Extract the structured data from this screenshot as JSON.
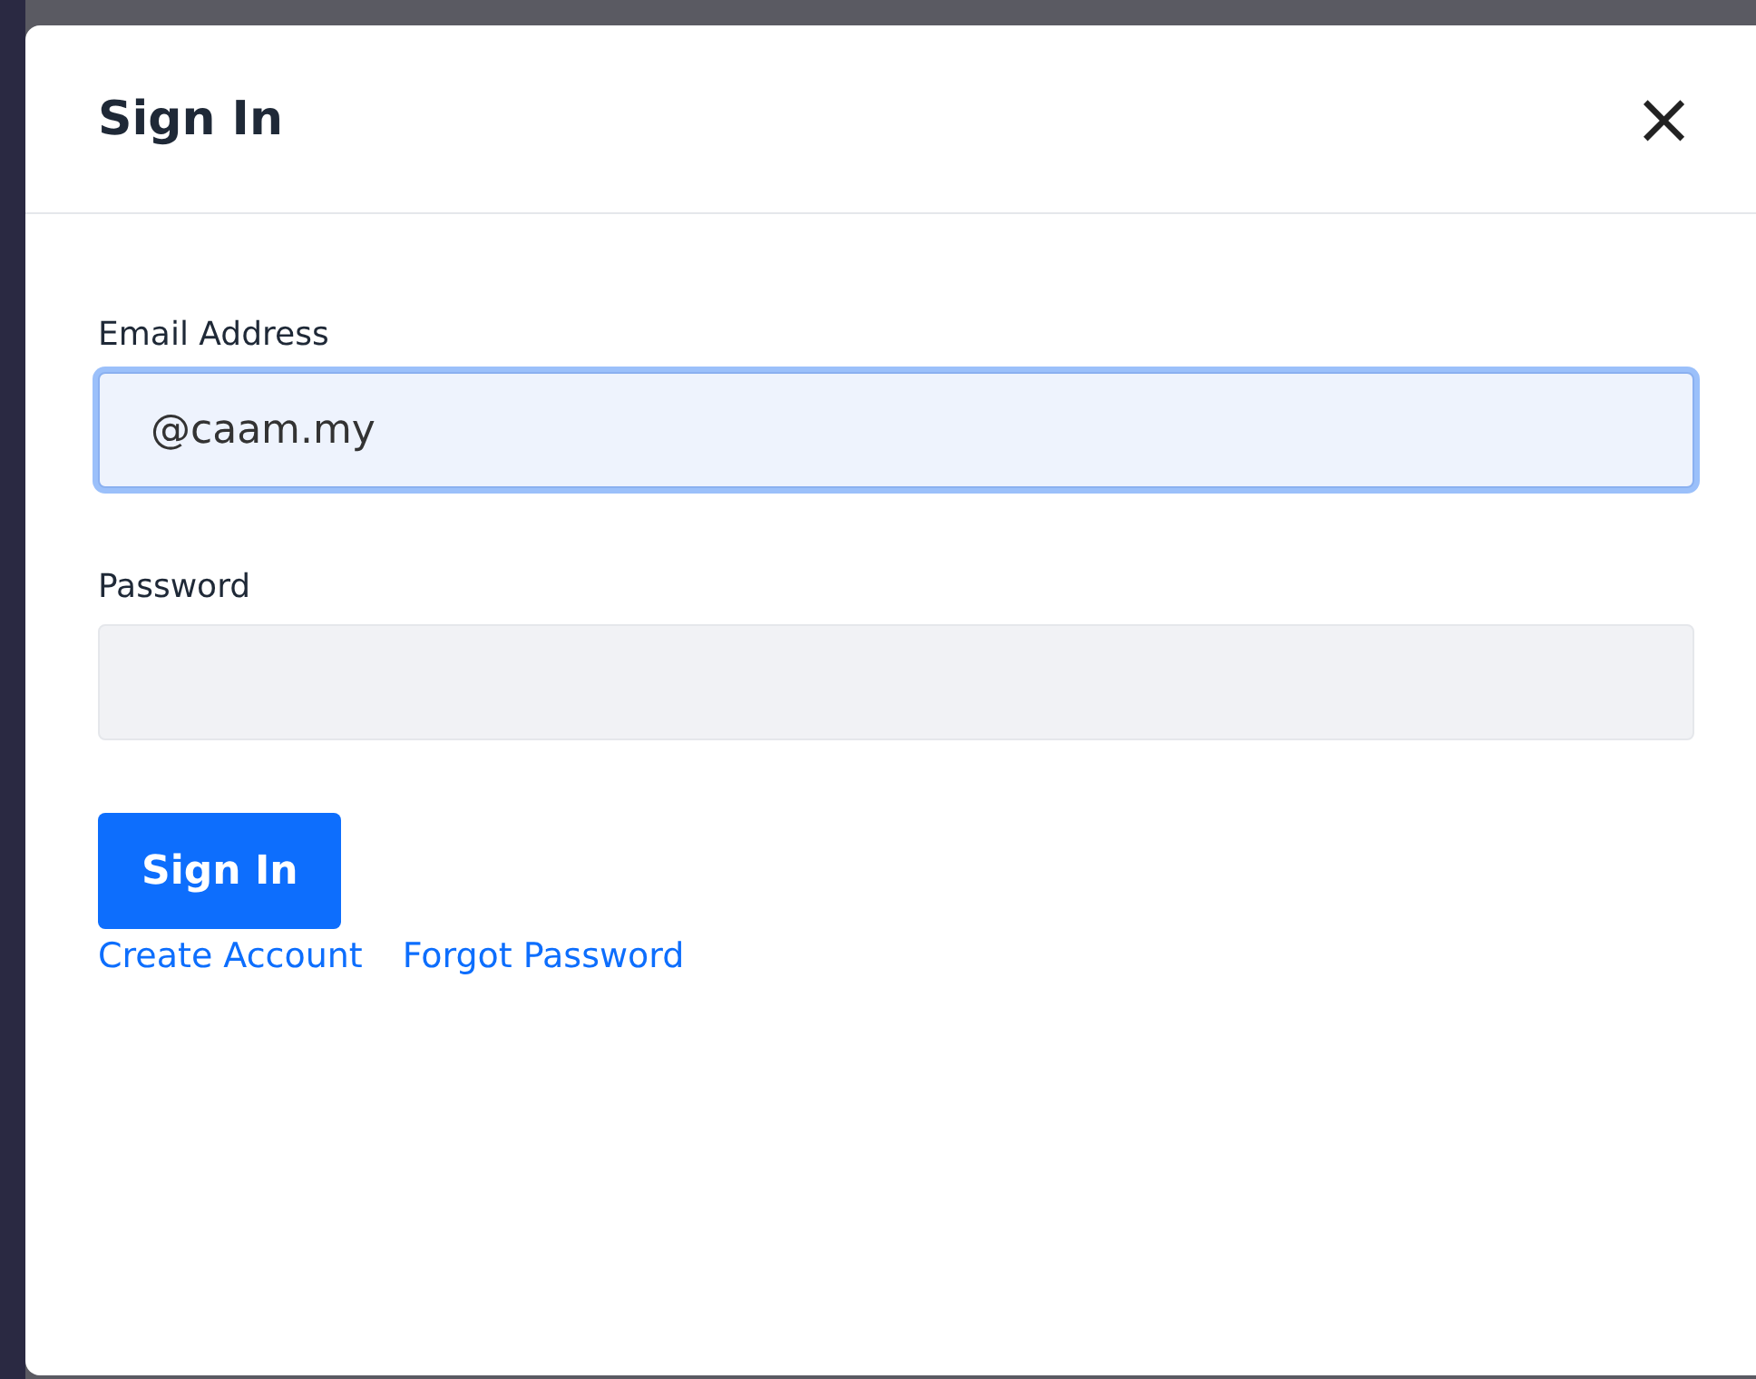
{
  "dialog": {
    "title": "Sign In",
    "close": "×"
  },
  "fields": [
    {
      "label": "Email Address",
      "value": "@caam.my",
      "focused": true
    },
    {
      "label": "Password",
      "focused": false
    }
  ],
  "submit": "Sign In",
  "links": [
    "Create Account",
    "Forgot Password"
  ]
}
